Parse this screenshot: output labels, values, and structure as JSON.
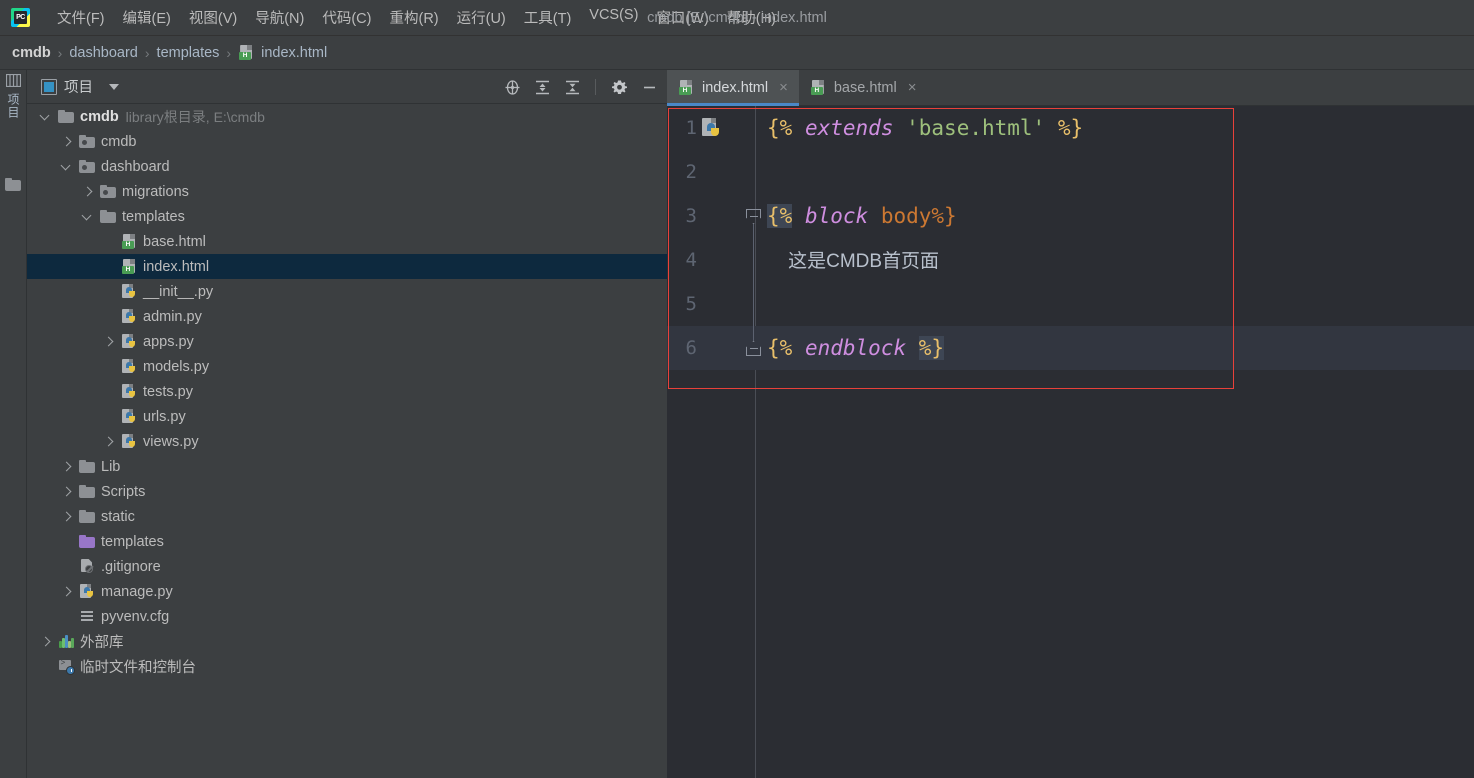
{
  "window": {
    "title": "cmdb [E:\\cmdb] - index.html",
    "logo_text": "PC"
  },
  "menubar": {
    "items": [
      {
        "label": "文件(F)",
        "name": "menu-file"
      },
      {
        "label": "编辑(E)",
        "name": "menu-edit"
      },
      {
        "label": "视图(V)",
        "name": "menu-view"
      },
      {
        "label": "导航(N)",
        "name": "menu-navigate"
      },
      {
        "label": "代码(C)",
        "name": "menu-code"
      },
      {
        "label": "重构(R)",
        "name": "menu-refactor"
      },
      {
        "label": "运行(U)",
        "name": "menu-run"
      },
      {
        "label": "工具(T)",
        "name": "menu-tools"
      },
      {
        "label": "VCS(S)",
        "name": "menu-vcs"
      },
      {
        "label": "窗口(W)",
        "name": "menu-window"
      },
      {
        "label": "帮助(H)",
        "name": "menu-help"
      }
    ]
  },
  "breadcrumb": {
    "separator": "›",
    "items": [
      {
        "label": "cmdb",
        "icon": "none",
        "root": true
      },
      {
        "label": "dashboard",
        "icon": "none",
        "root": false
      },
      {
        "label": "templates",
        "icon": "none",
        "root": false
      },
      {
        "label": "index.html",
        "icon": "html-file-icon",
        "root": false
      }
    ]
  },
  "toolstrip": {
    "project_label": "项目",
    "project_icon": "project-tool-icon",
    "folder_icon": "folder-tool-icon"
  },
  "project_panel": {
    "title": "项目",
    "title_icon": "project-panel-icon",
    "dropdown_icon": "chevron-down-icon",
    "tools": [
      {
        "name": "locate-file-icon",
        "label": "crosshair"
      },
      {
        "name": "expand-all-icon",
        "label": "expand-all"
      },
      {
        "name": "collapse-all-icon",
        "label": "collapse-all"
      },
      {
        "name": "settings-gear-icon",
        "label": "gear"
      },
      {
        "name": "hide-panel-icon",
        "label": "minimize"
      }
    ],
    "tree": [
      {
        "label": "cmdb",
        "note": "library根目录, E:\\cmdb",
        "indent": 0,
        "chevron": "down",
        "icon": "folder",
        "bold": true,
        "selected": false
      },
      {
        "label": "cmdb",
        "note": "",
        "indent": 1,
        "chevron": "right",
        "icon": "folder-pkg",
        "bold": false,
        "selected": false
      },
      {
        "label": "dashboard",
        "note": "",
        "indent": 1,
        "chevron": "down",
        "icon": "folder-pkg",
        "bold": false,
        "selected": false
      },
      {
        "label": "migrations",
        "note": "",
        "indent": 2,
        "chevron": "right",
        "icon": "folder-pkg",
        "bold": false,
        "selected": false
      },
      {
        "label": "templates",
        "note": "",
        "indent": 2,
        "chevron": "down",
        "icon": "folder",
        "bold": false,
        "selected": false
      },
      {
        "label": "base.html",
        "note": "",
        "indent": 3,
        "chevron": "none",
        "icon": "html",
        "bold": false,
        "selected": false
      },
      {
        "label": "index.html",
        "note": "",
        "indent": 3,
        "chevron": "none",
        "icon": "html",
        "bold": false,
        "selected": true
      },
      {
        "label": "__init__.py",
        "note": "",
        "indent": 3,
        "chevron": "none",
        "icon": "py",
        "bold": false,
        "selected": false
      },
      {
        "label": "admin.py",
        "note": "",
        "indent": 3,
        "chevron": "none",
        "icon": "py",
        "bold": false,
        "selected": false
      },
      {
        "label": "apps.py",
        "note": "",
        "indent": 3,
        "chevron": "right",
        "icon": "py",
        "bold": false,
        "selected": false
      },
      {
        "label": "models.py",
        "note": "",
        "indent": 3,
        "chevron": "none",
        "icon": "py",
        "bold": false,
        "selected": false
      },
      {
        "label": "tests.py",
        "note": "",
        "indent": 3,
        "chevron": "none",
        "icon": "py",
        "bold": false,
        "selected": false
      },
      {
        "label": "urls.py",
        "note": "",
        "indent": 3,
        "chevron": "none",
        "icon": "py",
        "bold": false,
        "selected": false
      },
      {
        "label": "views.py",
        "note": "",
        "indent": 3,
        "chevron": "right",
        "icon": "py",
        "bold": false,
        "selected": false
      },
      {
        "label": "Lib",
        "note": "",
        "indent": 1,
        "chevron": "right",
        "icon": "folder",
        "bold": false,
        "selected": false
      },
      {
        "label": "Scripts",
        "note": "",
        "indent": 1,
        "chevron": "right",
        "icon": "folder",
        "bold": false,
        "selected": false
      },
      {
        "label": "static",
        "note": "",
        "indent": 1,
        "chevron": "right",
        "icon": "folder",
        "bold": false,
        "selected": false
      },
      {
        "label": "templates",
        "note": "",
        "indent": 1,
        "chevron": "none",
        "icon": "folder-tmpl",
        "bold": false,
        "selected": false
      },
      {
        "label": ".gitignore",
        "note": "",
        "indent": 1,
        "chevron": "none",
        "icon": "git",
        "bold": false,
        "selected": false
      },
      {
        "label": "manage.py",
        "note": "",
        "indent": 1,
        "chevron": "right",
        "icon": "py",
        "bold": false,
        "selected": false
      },
      {
        "label": "pyvenv.cfg",
        "note": "",
        "indent": 1,
        "chevron": "none",
        "icon": "cfg",
        "bold": false,
        "selected": false
      },
      {
        "label": "外部库",
        "note": "",
        "indent": 0,
        "chevron": "right",
        "icon": "lib",
        "bold": false,
        "selected": false
      },
      {
        "label": "临时文件和控制台",
        "note": "",
        "indent": 0,
        "chevron": "none",
        "icon": "console",
        "bold": false,
        "selected": false
      }
    ]
  },
  "editor": {
    "tabs": [
      {
        "label": "index.html",
        "icon": "html-file-icon",
        "active": true,
        "close": "×"
      },
      {
        "label": "base.html",
        "icon": "html-file-icon",
        "active": false,
        "close": "×"
      }
    ],
    "gutter_icon": "python-related-file-icon",
    "lines": [
      {
        "number": "1",
        "highlight": false,
        "fold": "none",
        "gutter_icon": true,
        "tokens": [
          {
            "t": "{%",
            "c": "br"
          },
          {
            "t": " ",
            "c": "plain"
          },
          {
            "t": "extends",
            "c": "tag"
          },
          {
            "t": " ",
            "c": "plain"
          },
          {
            "t": "'base.html'",
            "c": "str"
          },
          {
            "t": " ",
            "c": "plain"
          },
          {
            "t": "%}",
            "c": "br"
          }
        ]
      },
      {
        "number": "2",
        "highlight": false,
        "fold": "none",
        "gutter_icon": false,
        "tokens": []
      },
      {
        "number": "3",
        "highlight": false,
        "fold": "open",
        "gutter_icon": false,
        "tokens": [
          {
            "t": "{%",
            "c": "br hl"
          },
          {
            "t": " ",
            "c": "plain"
          },
          {
            "t": "block",
            "c": "tag"
          },
          {
            "t": " ",
            "c": "plain"
          },
          {
            "t": "body%}",
            "c": "kw"
          }
        ]
      },
      {
        "number": "4",
        "highlight": false,
        "fold": "line",
        "gutter_icon": false,
        "tokens": [
          {
            "t": "    这是CMDB首页面",
            "c": "txt"
          }
        ]
      },
      {
        "number": "5",
        "highlight": false,
        "fold": "line",
        "gutter_icon": false,
        "tokens": []
      },
      {
        "number": "6",
        "highlight": true,
        "fold": "end",
        "gutter_icon": false,
        "tokens": [
          {
            "t": "{%",
            "c": "br"
          },
          {
            "t": " ",
            "c": "plain"
          },
          {
            "t": "endblock",
            "c": "tag"
          },
          {
            "t": " ",
            "c": "plain"
          },
          {
            "t": "%}",
            "c": "br hl"
          }
        ]
      }
    ]
  },
  "colors": {
    "panel_bg": "#3c3f41",
    "editor_bg": "#2b2d33",
    "selection": "#0d293e",
    "tab_active_underline": "#4a88c7",
    "annotation_box": "#e8413a",
    "brace": "#e8bf6a",
    "tag": "#cf8ee0",
    "string": "#9ec07c",
    "keyword": "#cc7832"
  }
}
